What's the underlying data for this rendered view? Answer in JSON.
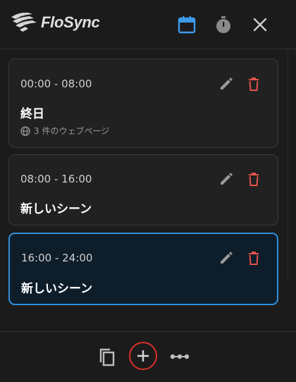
{
  "app": {
    "name": "FloSync"
  },
  "header": {
    "icons": [
      "calendar-icon",
      "timer-icon",
      "close-icon"
    ],
    "accent": "#3d9be9"
  },
  "scenes": [
    {
      "time": "00:00 - 08:00",
      "title": "終日",
      "pages": "3 件のウェブページ",
      "active": false
    },
    {
      "time": "08:00 - 16:00",
      "title": "新しいシーン",
      "active": false
    },
    {
      "time": "16:00 - 24:00",
      "title": "新しいシーン",
      "active": true
    }
  ],
  "footer": {
    "icons": [
      "copy-icon",
      "add-icon",
      "more-icon"
    ],
    "highlight_color": "#d9302a"
  },
  "colors": {
    "delete": "#e5534b",
    "active_border": "#2e8fdc"
  }
}
